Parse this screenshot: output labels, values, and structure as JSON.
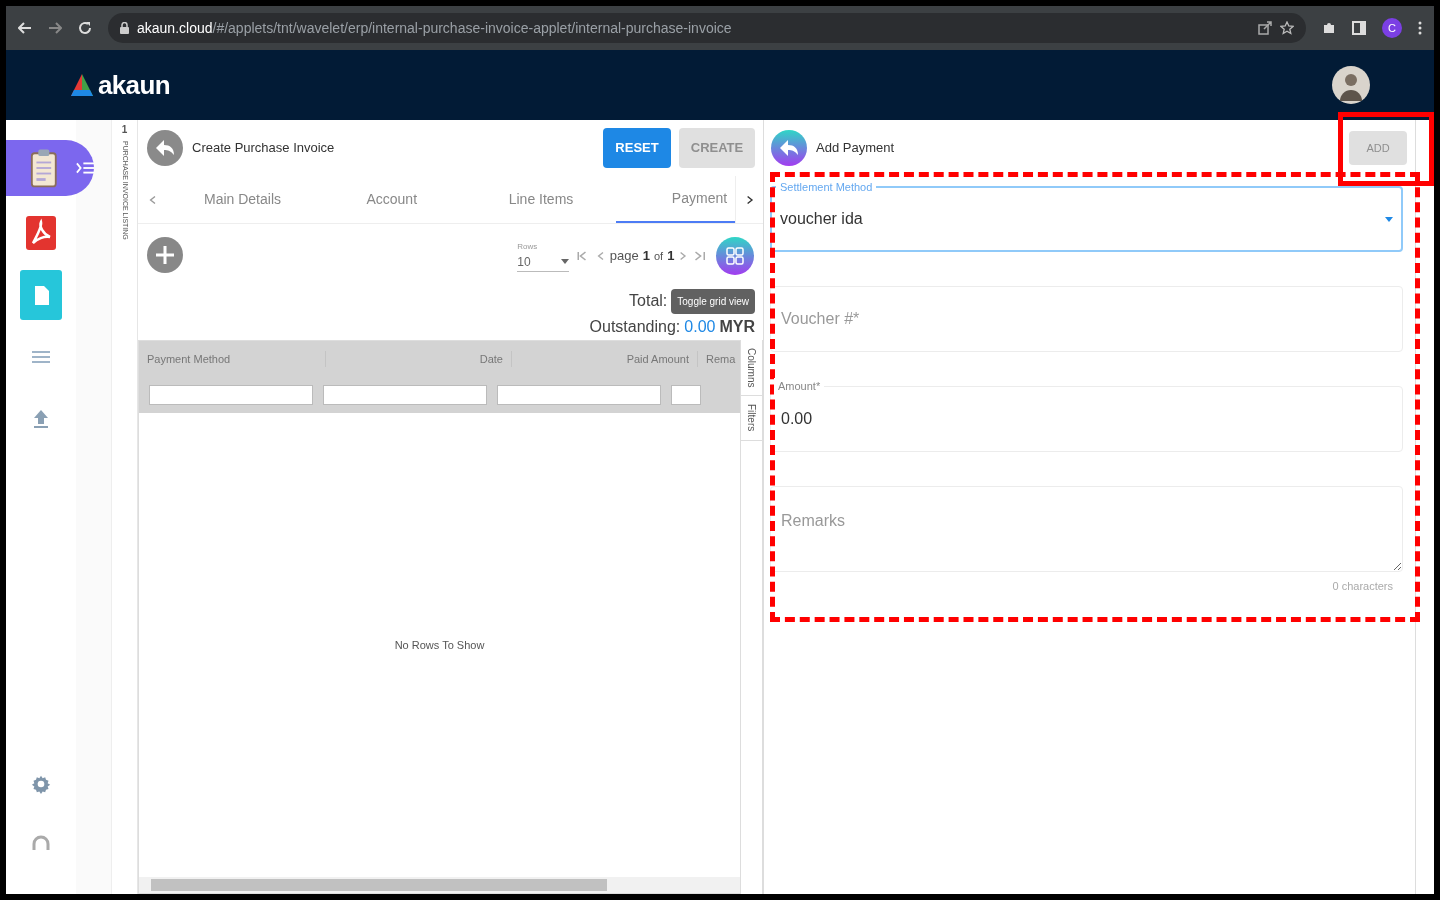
{
  "browser": {
    "host": "akaun.cloud",
    "path": "/#/applets/tnt/wavelet/erp/internal-purchase-invoice-applet/internal-purchase-invoice",
    "profile": "C"
  },
  "app": {
    "logo": "akaun"
  },
  "sidebar": {
    "items": [
      {
        "kind": "clipboard",
        "selected": true
      },
      {
        "kind": "pdf",
        "selected": false
      },
      {
        "kind": "doc",
        "selected": false
      },
      {
        "kind": "list",
        "selected": false
      },
      {
        "kind": "upload",
        "selected": false
      }
    ],
    "bottom": [
      {
        "kind": "gear"
      },
      {
        "kind": "headset"
      }
    ]
  },
  "listing_strip": {
    "count": "1",
    "label": "PURCHASE INVOICE LISTING"
  },
  "main": {
    "title": "Create Purchase Invoice",
    "buttons": [
      {
        "label": "RESET",
        "disabled": false
      },
      {
        "label": "CREATE",
        "disabled": true
      }
    ],
    "tabs": [
      {
        "label": "Main Details",
        "selected": false
      },
      {
        "label": "Account",
        "selected": false
      },
      {
        "label": "Line Items",
        "selected": false
      },
      {
        "label": "Payment",
        "selected": true
      }
    ],
    "pager": {
      "rows_label": "Rows",
      "rows": "10",
      "page_word": "page",
      "page": "1",
      "of_word": "of",
      "pages": "1"
    },
    "tooltip": "Toggle grid view",
    "total_label": "Total:",
    "outstanding_label": "Outstanding:",
    "outstanding_value": "0.00",
    "currency": "MYR",
    "table": {
      "columns": [
        "Payment Method",
        "Date",
        "Paid Amount",
        "Rema"
      ],
      "empty": "No Rows To Show",
      "side_tabs": [
        "Columns",
        "Filters"
      ]
    }
  },
  "panel": {
    "title": "Add Payment",
    "button": {
      "label": "ADD",
      "disabled": true
    },
    "fields": [
      {
        "kind": "select",
        "label": "Settlement Method",
        "value": "voucher ida",
        "focused": true
      },
      {
        "kind": "input",
        "placeholder": "Voucher #*"
      },
      {
        "kind": "input",
        "label": "Amount*",
        "value": "0.00"
      },
      {
        "kind": "textarea",
        "placeholder": "Remarks",
        "counter": "0 characters"
      }
    ]
  },
  "annotations": [
    {
      "kind": "solid"
    },
    {
      "kind": "dashed"
    }
  ]
}
